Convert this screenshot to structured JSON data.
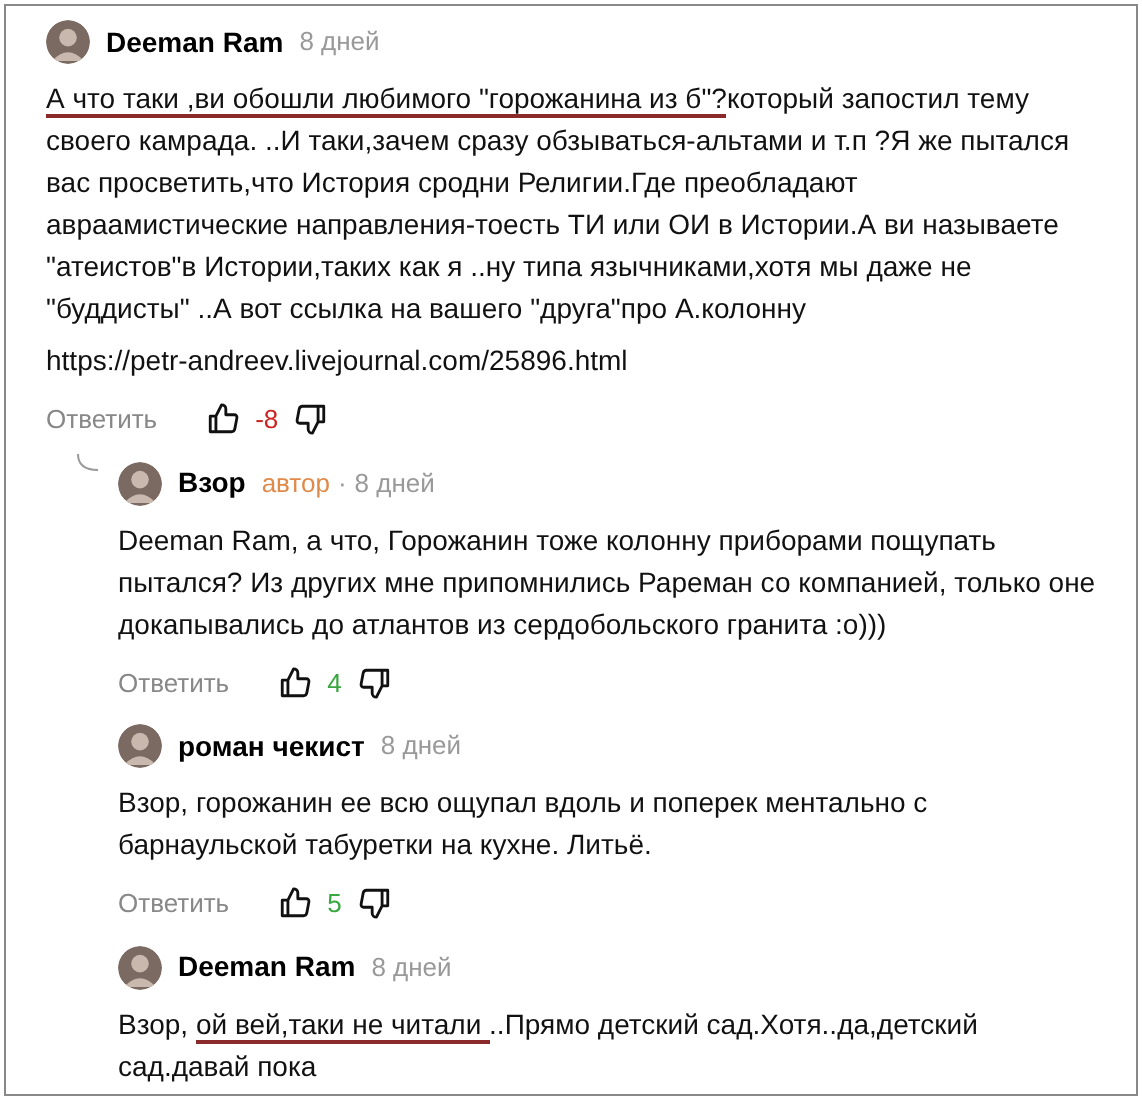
{
  "comments": [
    {
      "author": "Deeman Ram",
      "time": "8 дней",
      "body": [
        {
          "text": "А что таки ,ви обошли любимого \"горожанина из б\"?",
          "underlined": true
        },
        {
          "text": "который запостил тему своего камрада. ..И таки,зачем сразу обзываться-альтами и т.п ?Я же пытался вас просветить,что История сродни Религии.Где преобладают авраамистические направления-тоесть ТИ или ОИ в Истории.А ви называете \"атеистов\"в Истории,таких как я ..ну типа язычниками,хотя мы даже не \"буддисты\" ..А вот ссылка на вашего \"друга\"про А.колонну",
          "underlined": false
        }
      ],
      "link": "https://petr-andreev.livejournal.com/25896.html",
      "reply_label": "Ответить",
      "score": {
        "text": "-8",
        "color": "#cc2222"
      },
      "children": [
        {
          "author": "Взор",
          "author_badge": "автор",
          "separator": "·",
          "time": "8 дней",
          "body": [
            {
              "text": "Deeman Ram, а что, Горожанин тоже колонну приборами пощупать пытался? Из других мне припомнились Рареман со компанией, только оне докапывались до атлантов из сердобольского гранита :о)))",
              "underlined": false
            }
          ],
          "reply_label": "Ответить",
          "score": {
            "text": "4",
            "color": "#3aa640"
          }
        },
        {
          "author": "роман чекист",
          "time": "8 дней",
          "body": [
            {
              "text": "Взор, горожанин ее всю ощупал вдоль и поперек ментально с барнаульской табуретки на кухне. Литьё.",
              "underlined": false
            }
          ],
          "reply_label": "Ответить",
          "score": {
            "text": "5",
            "color": "#3aa640"
          }
        },
        {
          "author": "Deeman Ram",
          "time": "8 дней",
          "body": [
            {
              "text": "Взор, ",
              "underlined": false
            },
            {
              "text": "ой вей,таки не читали ",
              "underlined": true
            },
            {
              "text": "..Прямо детский сад.Хотя..да,детский сад.давай пока",
              "underlined": false
            }
          ]
        }
      ]
    }
  ]
}
